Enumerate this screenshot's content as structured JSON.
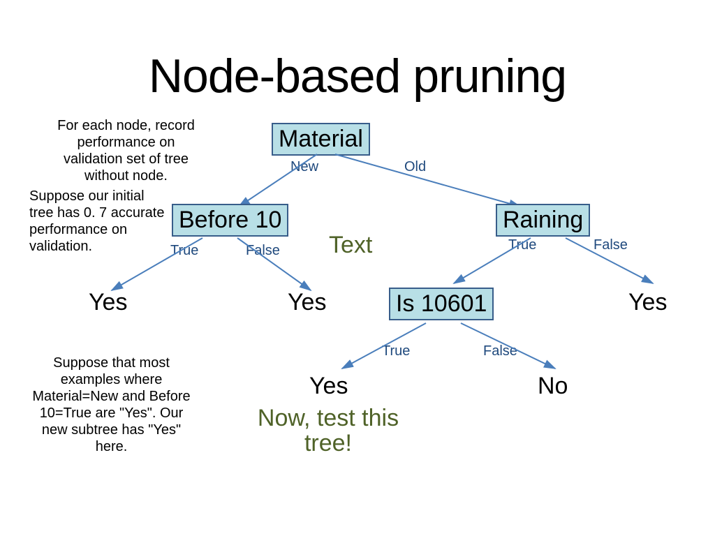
{
  "title": "Node-based pruning",
  "para1": "For each node, record performance on validation set of tree without node.",
  "para2": "Suppose our initial tree has 0. 7 accurate performance on validation.",
  "para3": "Suppose that most examples where Material=New and Before 10=True are \"Yes\". Our new subtree has \"Yes\" here.",
  "nodes": {
    "material": "Material",
    "before10": "Before 10",
    "raining": "Raining",
    "is10601": "Is 10601"
  },
  "edges": {
    "new": "New",
    "old": "Old",
    "true1": "True",
    "false1": "False",
    "true2": "True",
    "false2": "False",
    "true3": "True",
    "false3": "False"
  },
  "leaves": {
    "yes1": "Yes",
    "yes2": "Yes",
    "yes3": "Yes",
    "yes4": "Yes",
    "no": "No"
  },
  "callouts": {
    "text": "Text",
    "testtree": "Now, test this tree!"
  }
}
